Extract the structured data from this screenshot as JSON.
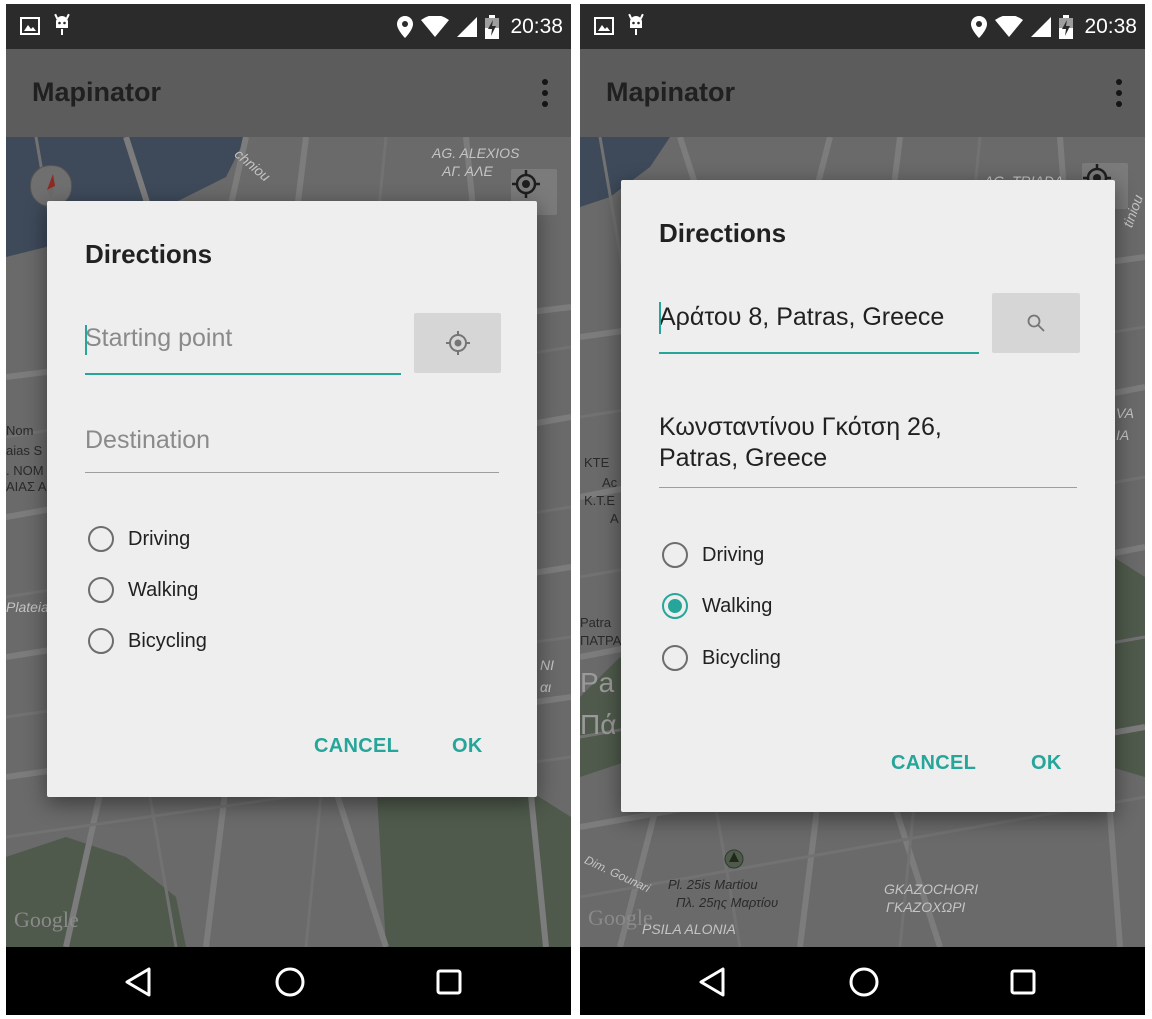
{
  "left_screen": {
    "status_bar": {
      "time": "20:38"
    },
    "app_bar": {
      "title": "Mapinator"
    },
    "map": {
      "labels": [
        "AG. ALEXIOS",
        "ΑΓ. ΑΛΕ",
        "chniou",
        "Nom",
        "aias S",
        ". NOM",
        "ΑΙΑΣ Α",
        "Plateia",
        "NI",
        "αι"
      ],
      "google_logo": "Google"
    },
    "dialog": {
      "title": "Directions",
      "start_field": {
        "placeholder": "Starting point",
        "value": ""
      },
      "destination_field": {
        "placeholder": "Destination",
        "value": ""
      },
      "start_button_icon": "my-location-icon",
      "modes": [
        {
          "label": "Driving",
          "checked": false
        },
        {
          "label": "Walking",
          "checked": false
        },
        {
          "label": "Bicycling",
          "checked": false
        }
      ],
      "cancel_label": "CANCEL",
      "ok_label": "OK"
    }
  },
  "right_screen": {
    "status_bar": {
      "time": "20:38"
    },
    "app_bar": {
      "title": "Mapinator"
    },
    "map": {
      "labels": [
        "AG. TRIADA",
        "tiniou",
        "KTE",
        "Ac",
        "K.T.E",
        "A",
        "VA",
        "IA",
        "Patra",
        "ΠΑΤΡΑ",
        "Pa",
        "Πά",
        "Dim. Gounari",
        "Pl. 25is Martiou",
        "Πλ. 25ης Μαρτίου",
        "GKAZOCHORI",
        "ΓΚΑΖΟΧΩΡΙ",
        "PSILA ALONIA"
      ],
      "google_logo": "Google"
    },
    "dialog": {
      "title": "Directions",
      "start_field": {
        "placeholder": "Starting point",
        "value": "Αράτου 8, Patras, Greece"
      },
      "destination_field": {
        "placeholder": "Destination",
        "value": "Κωνσταντίνου Γκότση 26,\nPatras, Greece"
      },
      "start_button_icon": "search-icon",
      "modes": [
        {
          "label": "Driving",
          "checked": false
        },
        {
          "label": "Walking",
          "checked": true
        },
        {
          "label": "Bicycling",
          "checked": false
        }
      ],
      "cancel_label": "CANCEL",
      "ok_label": "OK"
    }
  },
  "colors": {
    "accent": "#26a69a",
    "dialog_background": "#eeeeee",
    "status_bar": "#2b2b2b",
    "app_bar_dimmed": "#5c5c5c"
  }
}
